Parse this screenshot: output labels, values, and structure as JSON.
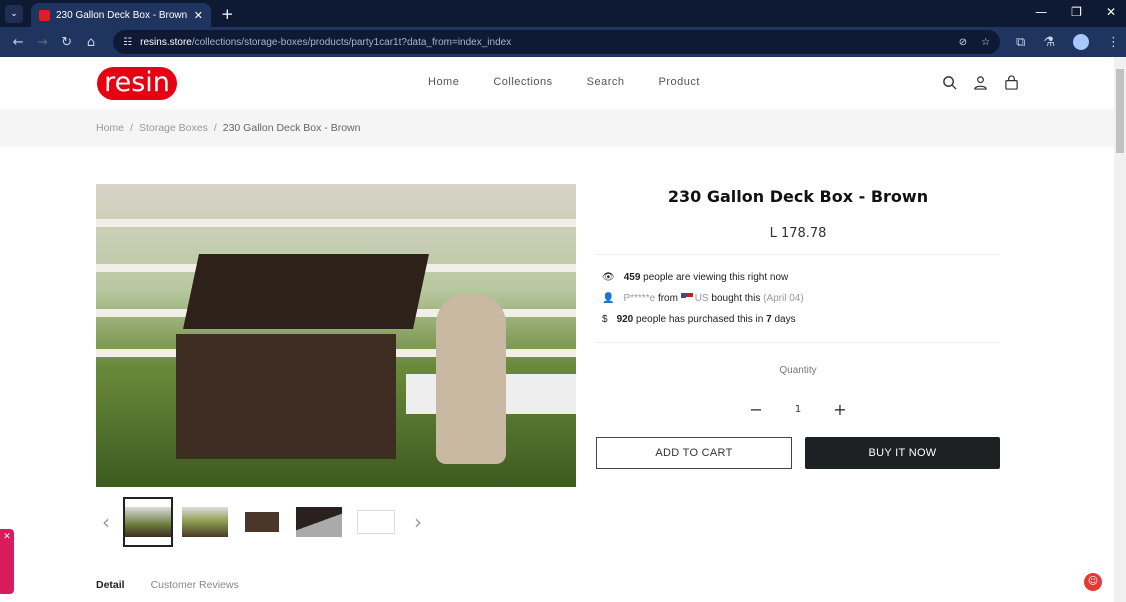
{
  "browser": {
    "tab_title": "230 Gallon Deck Box - Brown",
    "url_domain": "resins.store",
    "url_path": "/collections/storage-boxes/products/party1car1t?data_from=index_index"
  },
  "header": {
    "logo": "resin",
    "menu": [
      "Home",
      "Collections",
      "Search",
      "Product"
    ]
  },
  "breadcrumb": [
    "Home",
    "Storage Boxes",
    "230 Gallon Deck Box - Brown"
  ],
  "product": {
    "title": "230 Gallon Deck Box - Brown",
    "price": "L 178.78",
    "viewing_count": "459",
    "viewing_text": "people are viewing this right now",
    "buyer_name": "P*****e",
    "buyer_from": "from",
    "buyer_country": "US",
    "buyer_text": "bought this",
    "buyer_date": "(April 04)",
    "purchased_count": "920",
    "purchased_text": "people has purchased this in",
    "purchased_days": "7",
    "purchased_unit": "days",
    "quantity_label": "Quantity",
    "quantity": "1",
    "add_to_cart": "ADD TO CART",
    "buy_now": "BUY IT NOW"
  },
  "tabs": [
    "Detail",
    "Customer Reviews"
  ],
  "colors": {
    "brand": "#e60012",
    "buy_button": "#1e2124",
    "side_widget": "#d81b5a"
  }
}
